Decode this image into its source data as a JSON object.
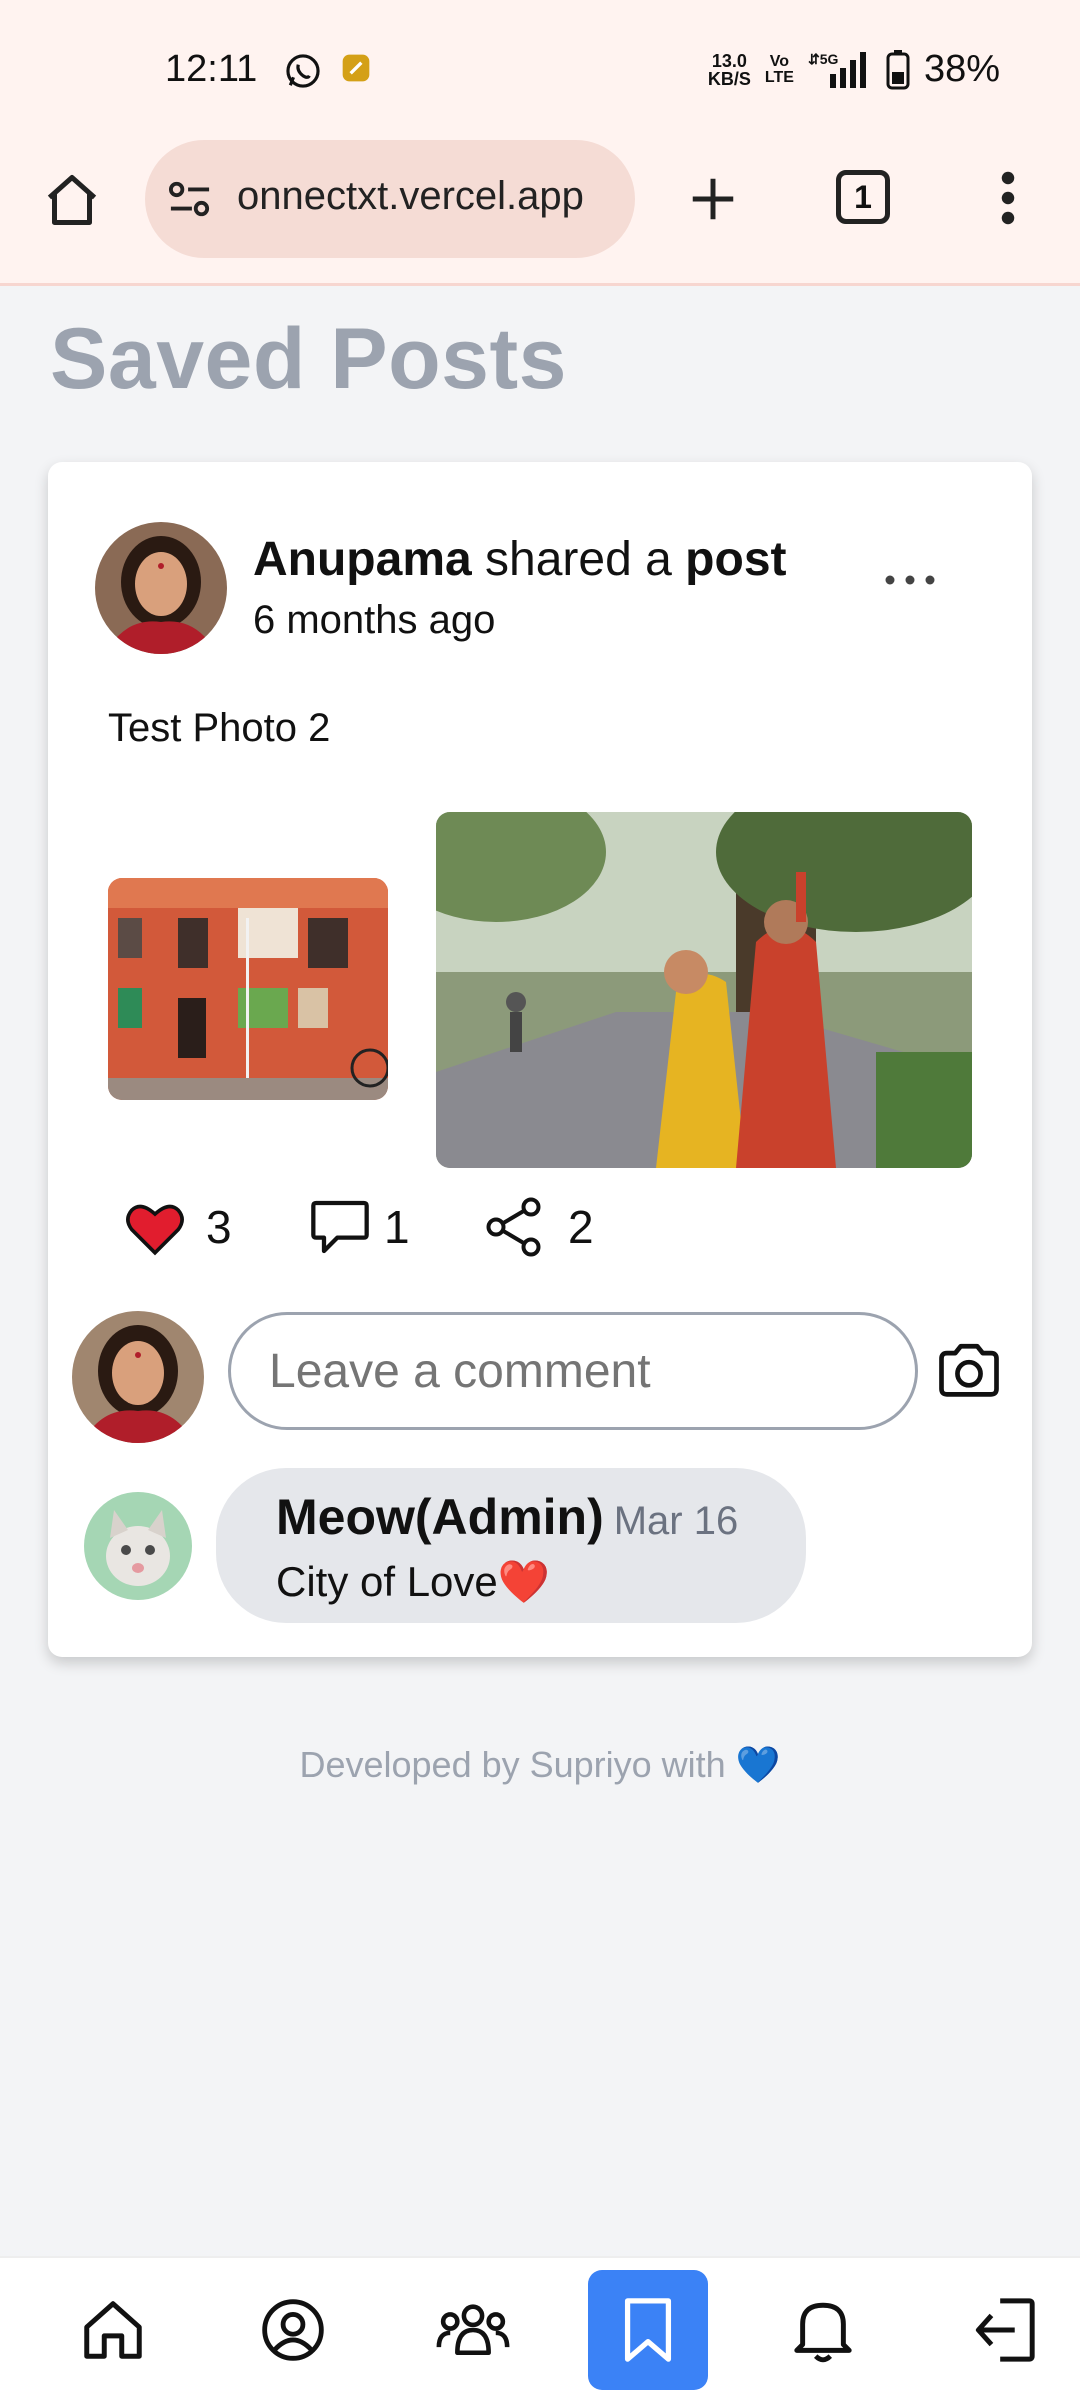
{
  "status_bar": {
    "time": "12:11",
    "net_speed_value": "13.0",
    "net_speed_unit": "KB/S",
    "volte_top": "Vo",
    "volte_bottom": "LTE",
    "signal": "5G",
    "battery": "38%"
  },
  "browser": {
    "url": "onnectxt.vercel.app",
    "tab_count": "1"
  },
  "page": {
    "title": "Saved Posts"
  },
  "post": {
    "author": "Anupama",
    "shared_text": " shared a ",
    "post_word": "post",
    "time_ago": "6 months ago",
    "text": "Test Photo 2",
    "likes": "3",
    "comments": "1",
    "shares": "2"
  },
  "comment_form": {
    "placeholder": "Leave a comment"
  },
  "comments": [
    {
      "author": "Meow(Admin)",
      "date": "Mar 16",
      "text": "City of Love❤️"
    }
  ],
  "footer": {
    "text": "Developed by Supriyo with 💙"
  },
  "colors": {
    "accent": "#3b82f6",
    "like": "#e11d2e",
    "title_gray": "#9ca3af"
  },
  "bottom_nav": [
    "home-icon",
    "profile-icon",
    "friends-icon",
    "bookmark-icon",
    "bell-icon",
    "logout-icon"
  ]
}
